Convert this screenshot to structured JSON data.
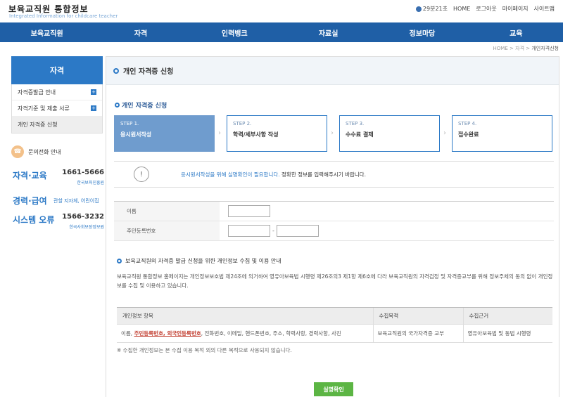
{
  "header": {
    "logo_title": "보육교직원 통합정보",
    "logo_subtitle": "Integrated Information for childcare teacher",
    "timer": "29분21초",
    "util_links": [
      "HOME",
      "로그아웃",
      "마이페이지",
      "사이트맵"
    ]
  },
  "nav": [
    "보육교직원",
    "자격",
    "인력뱅크",
    "자료실",
    "정보마당",
    "교육"
  ],
  "breadcrumb": {
    "home": "HOME",
    "sep1": ">",
    "level1": "자격",
    "sep2": ">",
    "current": "개인자격신청"
  },
  "sidebar": {
    "title": "자격",
    "items": [
      {
        "label": "자격증발급 안내",
        "expand": "+"
      },
      {
        "label": "자격기준 및 제출 서류",
        "expand": "+"
      },
      {
        "label": "개인 자격증 신청"
      }
    ],
    "contact_title": "문의전화 안내",
    "contacts": [
      {
        "label": "자격·교육",
        "number": "1661-5666",
        "org": "한국보육진흥원"
      },
      {
        "label": "경력·급여",
        "extra": "관할 지자체, 어린이집"
      },
      {
        "label": "시스템 오류",
        "number": "1566-3232",
        "org": "한국사회보장정보원"
      }
    ]
  },
  "main": {
    "page_title": "개인 자격증 신청",
    "section_title": "개인 자격증 신청",
    "steps": [
      {
        "no": "STEP 1.",
        "name": "응시원서작성"
      },
      {
        "no": "STEP 2.",
        "name": "학력/세부사항 작성"
      },
      {
        "no": "STEP 3.",
        "name": "수수료 결제"
      },
      {
        "no": "STEP 4.",
        "name": "접수완료"
      }
    ],
    "notice": {
      "highlight": "응시원서작성을 위해 실명확인이 필요합니다.",
      "rest": " 정확한 정보를 입력해주시기 바랍니다.",
      "icon": "!"
    },
    "form": {
      "name_label": "이름",
      "rrn_label": "주민등록번호",
      "dash": "-"
    },
    "consent": {
      "title": "보육교직원의 자격증 발급 신청을 위한 개인정보 수집 및 이용 안내",
      "body": "보육교직원 통합정보 홈페이지는 개인정보보호법 제24조에 의거하여 영유아보육법 시행령 제26조의3 제1항 제6호에 다라 보육교직원의 자격검정 및 자격증교부를 위해 정보주체의 동의 없이 개인정보를 수집 및 이용하고 있습니다.",
      "table_headers": [
        "개인정보 항목",
        "수집목적",
        "수집근거"
      ],
      "row": {
        "items_prefix": "이름, ",
        "items_underlined": "주민등록번호, 외국인등록번호",
        "items_suffix": ", 전화번호, 이메일, 핸드폰번호, 주소, 학력사항, 경력사항, 사진",
        "purpose": "보육교직원의 국가자격증 교부",
        "basis": "영유아보육법 및 동법 시행령"
      },
      "note": "※ 수집한 개인정보는 본 수집 이용 목적 외의 다른 목적으로 사용되지 않습니다."
    },
    "confirm_label": "실명확인"
  },
  "icons": {
    "timer": "clock-icon",
    "contact": "phone-person-icon",
    "notice": "exclamation-icon"
  },
  "colors": {
    "nav_bg": "#1f5fa6",
    "side_head": "#2c79c6",
    "active_step": "#6f9cce",
    "confirm": "#5cb544",
    "underline_red": "#c0392b"
  }
}
